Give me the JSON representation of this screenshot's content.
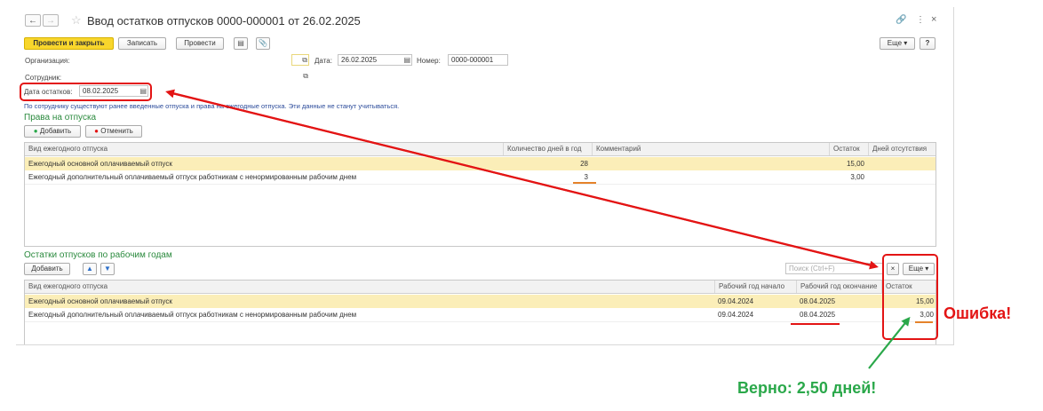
{
  "window": {
    "title": "Ввод остатков отпусков 0000-000001 от 26.02.2025",
    "more_label": "Еще",
    "help_label": "?"
  },
  "toolbar": {
    "post_close": "Провести и закрыть",
    "save": "Записать",
    "post": "Провести"
  },
  "form": {
    "org_label": "Организация:",
    "org_value": "",
    "date_label": "Дата:",
    "date_value": "26.02.2025",
    "number_label": "Номер:",
    "number_value": "0000-000001",
    "employee_label": "Сотрудник:",
    "employee_value": "",
    "balance_date_label": "Дата остатков:",
    "balance_date_value": "08.02.2025",
    "info_text": "По сотруднику существуют ранее введенные отпуска и права на ежегодные отпуска. Эти данные не станут учитываться."
  },
  "rights": {
    "title": "Права на отпуска",
    "add": "Добавить",
    "cancel": "Отменить",
    "columns": [
      "Вид ежегодного отпуска",
      "Количество дней в год",
      "Комментарий",
      "Остаток",
      "Дней отсутствия"
    ],
    "rows": [
      {
        "type": "Ежегодный основной оплачиваемый отпуск",
        "days": "28",
        "comment": "",
        "balance": "15,00",
        "absent": ""
      },
      {
        "type": "Ежегодный дополнительный оплачиваемый отпуск работникам с ненормированным рабочим днем",
        "days": "3",
        "comment": "",
        "balance": "3,00",
        "absent": ""
      }
    ]
  },
  "balances": {
    "title": "Остатки отпусков по рабочим годам",
    "add": "Добавить",
    "search_placeholder": "Поиск (Ctrl+F)",
    "clear": "×",
    "more": "Еще",
    "columns": [
      "Вид ежегодного отпуска",
      "Рабочий год начало",
      "Рабочий год окончание",
      "Остаток"
    ],
    "rows": [
      {
        "type": "Ежегодный основной оплачиваемый отпуск",
        "start": "09.04.2024",
        "end": "08.04.2025",
        "balance": "15,00"
      },
      {
        "type": "Ежегодный дополнительный оплачиваемый отпуск работникам с ненормированным рабочим днем",
        "start": "09.04.2024",
        "end": "08.04.2025",
        "balance": "3,00"
      }
    ]
  },
  "annotations": {
    "error": "Ошибка!",
    "correct": "Верно: 2,50 дней!",
    "error_color": "#e31414",
    "correct_color": "#2aa84a"
  },
  "icons": [
    "back-arrow-icon",
    "forward-arrow-icon",
    "star-icon",
    "link-icon",
    "kebab-icon",
    "close-icon",
    "calendar-icon",
    "open-icon",
    "plus-icon",
    "minus-icon",
    "up-arrow-icon",
    "down-arrow-icon",
    "report-icon",
    "attach-icon"
  ]
}
